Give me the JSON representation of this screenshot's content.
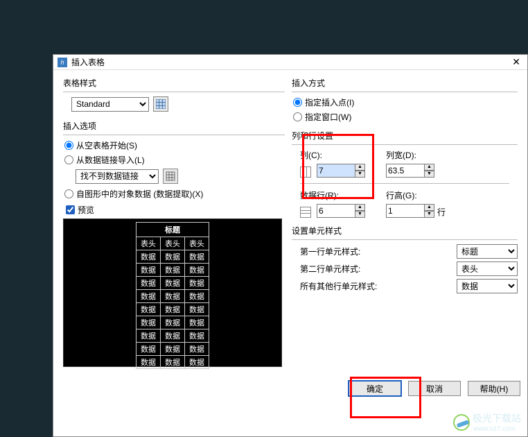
{
  "dialog": {
    "title": "插入表格",
    "close": "✕"
  },
  "left": {
    "style_group": "表格样式",
    "style_value": "Standard",
    "insert_options": "插入选项",
    "radio_empty": "从空表格开始(S)",
    "radio_link": "从数据链接导入(L)",
    "link_combo": "找不到数据链接",
    "radio_extract": "自图形中的对象数据 (数据提取)(X)",
    "preview": "预览",
    "pv": {
      "title": "标题",
      "header": "表头",
      "cell": "数据"
    }
  },
  "right": {
    "insert_mode": "插入方式",
    "radio_point": "指定插入点(I)",
    "radio_window": "指定窗口(W)",
    "col_row_group": "列和行设置",
    "col_label": "列(C):",
    "col_value": "7",
    "width_label": "列宽(D):",
    "width_value": "63.5",
    "datarow_label": "数据行(R):",
    "datarow_value": "6",
    "rowheight_label": "行高(G):",
    "rowheight_value": "1",
    "row_unit": "行",
    "cellstyle_group": "设置单元样式",
    "row1_label": "第一行单元样式:",
    "row1_value": "标题",
    "row2_label": "第二行单元样式:",
    "row2_value": "表头",
    "rowother_label": "所有其他行单元样式:",
    "rowother_value": "数据"
  },
  "buttons": {
    "ok": "确定",
    "cancel": "取消",
    "help": "帮助(H)"
  },
  "watermark": {
    "name": "极光下载站",
    "url": "www.xz7.com"
  }
}
